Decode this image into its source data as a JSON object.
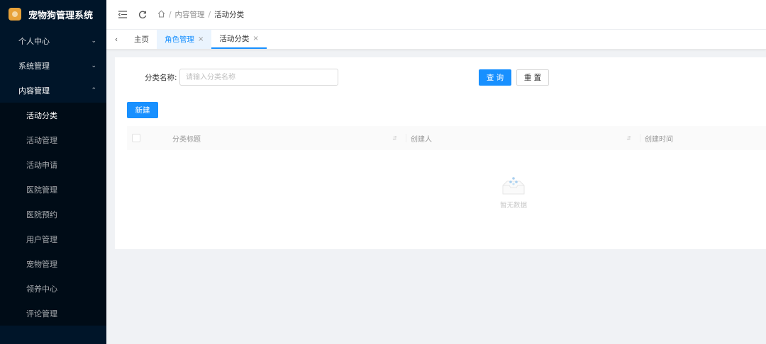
{
  "app": {
    "title": "宠物狗管理系统"
  },
  "sidebar": {
    "menus": [
      {
        "label": "个人中心",
        "expanded": false
      },
      {
        "label": "系统管理",
        "expanded": false
      },
      {
        "label": "内容管理",
        "expanded": true
      }
    ],
    "sub_items": [
      {
        "label": "活动分类",
        "active": true
      },
      {
        "label": "活动管理"
      },
      {
        "label": "活动申请"
      },
      {
        "label": "医院管理"
      },
      {
        "label": "医院预约"
      },
      {
        "label": "用户管理"
      },
      {
        "label": "宠物管理"
      },
      {
        "label": "领养中心"
      },
      {
        "label": "评论管理"
      }
    ]
  },
  "header": {
    "breadcrumb": [
      "内容管理",
      "活动分类"
    ]
  },
  "tabs": [
    {
      "label": "主页"
    },
    {
      "label": "角色管理",
      "closable": true
    },
    {
      "label": "活动分类",
      "closable": true,
      "active": true
    }
  ],
  "search": {
    "label": "分类名称:",
    "placeholder": "请输入分类名称",
    "value": "",
    "query_label": "查 询",
    "reset_label": "重 置"
  },
  "toolbar": {
    "new_label": "新建"
  },
  "table": {
    "columns": [
      "分类标题",
      "创建人",
      "创建时间"
    ],
    "rows": [],
    "empty_text": "暂无数据"
  },
  "colors": {
    "sidebar_bg": "#001529",
    "primary": "#1890ff"
  }
}
